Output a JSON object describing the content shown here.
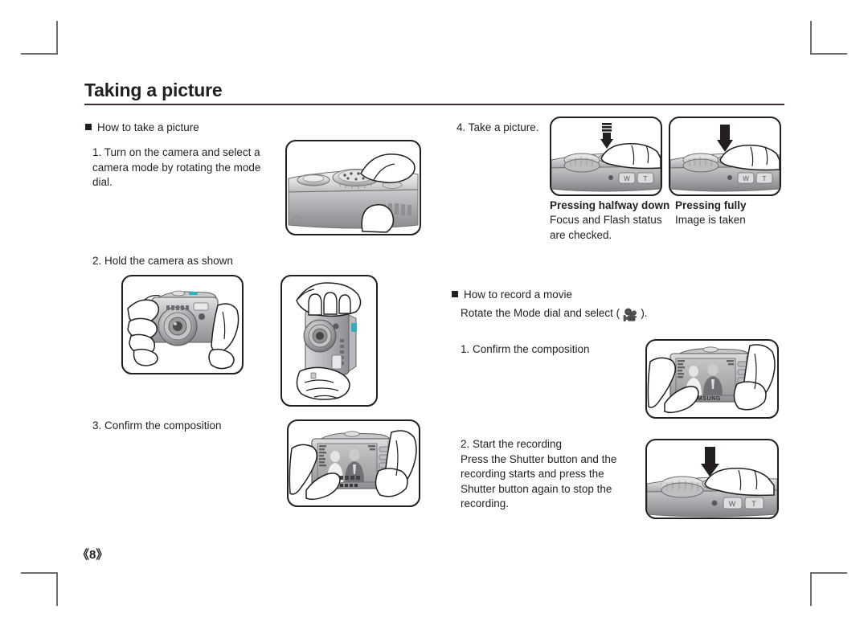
{
  "page": {
    "title": "Taking a picture",
    "number": "《8》"
  },
  "left_column": {
    "section_heading": "How to take a picture",
    "step1": "1. Turn on the camera and select a\n    camera mode by rotating the mode\n    dial.",
    "step2": "2. Hold the camera as shown",
    "step3": "3. Confirm the composition"
  },
  "right_column": {
    "step4": "4. Take a picture.",
    "press_half_label": "Pressing halfway down",
    "press_half_desc": "Focus and Flash status\nare checked.",
    "press_full_label": "Pressing fully",
    "press_full_desc": "Image is taken",
    "movie_heading": "How to record a movie",
    "movie_intro_before": "Rotate the Mode dial and select ( ",
    "movie_icon_glyph": "🎥",
    "movie_intro_after": " ).",
    "movie_step1": "1. Confirm the composition",
    "movie_step2": "2. Start the recording\n    Press the Shutter button and the\n    recording starts and press the\n    Shutter button again to stop the\n    recording."
  },
  "figures": {
    "mode_dial": "camera-top-mode-dial-illustration",
    "hold_front": "camera-held-front-view-illustration",
    "hold_vertical": "camera-held-vertical-illustration",
    "lcd_compose": "camera-rear-lcd-composition-illustration",
    "shutter_half": "shutter-pressed-halfway-illustration",
    "shutter_full": "shutter-pressed-fully-illustration",
    "movie_compose": "movie-rear-lcd-composition-illustration",
    "movie_shutter": "movie-shutter-press-illustration"
  },
  "colors": {
    "ink": "#231f20",
    "rule": "#3b2f33",
    "crop_mark": "#6d6e71",
    "body_light": "#d9dadb",
    "body_mid": "#b0b2b5",
    "body_dark": "#808285",
    "accent_cyan": "#2ab0c5",
    "accent_magenta": "#b03a8c"
  }
}
